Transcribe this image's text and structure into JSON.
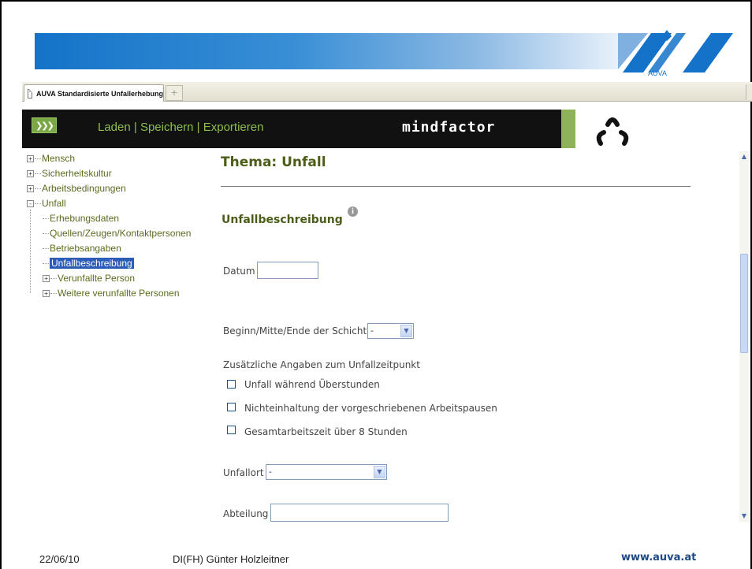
{
  "browser": {
    "tab_title": "AUVA Standardisierte Unfallerhebung",
    "new_tab": "+"
  },
  "banner": {
    "logo_text": "AUVA",
    "brand_color": "#1473c8"
  },
  "app_bar": {
    "menu": [
      "Laden",
      "Speichern",
      "Exportieren"
    ],
    "separator": " | ",
    "brand": "mindfactor",
    "accent": "#8db25a"
  },
  "tree": {
    "items": [
      {
        "label": "Mensch",
        "level": 1,
        "toggle": "+"
      },
      {
        "label": "Sicherheitskultur",
        "level": 1,
        "toggle": "+"
      },
      {
        "label": "Arbeitsbedingungen",
        "level": 1,
        "toggle": "+"
      },
      {
        "label": "Unfall",
        "level": 1,
        "toggle": "-"
      },
      {
        "label": "Erhebungsdaten",
        "level": 2,
        "toggle": ""
      },
      {
        "label": "Quellen/Zeugen/Kontaktpersonen",
        "level": 2,
        "toggle": ""
      },
      {
        "label": "Betriebsangaben",
        "level": 2,
        "toggle": ""
      },
      {
        "label": "Unfallbeschreibung",
        "level": 2,
        "toggle": "",
        "selected": true
      },
      {
        "label": "Verunfallte Person",
        "level": 2,
        "toggle": "+"
      },
      {
        "label": "Weitere verunfallte Personen",
        "level": 2,
        "toggle": "+"
      }
    ]
  },
  "main": {
    "title": "Thema: Unfall",
    "section": "Unfallbeschreibung",
    "info_icon": "i",
    "fields": {
      "datum_label": "Datum",
      "datum_value": "",
      "schicht_label": "Beginn/Mitte/Ende der Schicht",
      "schicht_value": "-",
      "zusatz_label": "Zusätzliche Angaben zum Unfallzeitpunkt",
      "checkboxes": [
        {
          "label": "Unfall während Überstunden",
          "checked": false
        },
        {
          "label": "Nichteinhaltung der vorgeschriebenen Arbeitspausen",
          "checked": false
        },
        {
          "label": "Gesamtarbeitszeit über 8 Stunden",
          "checked": false
        }
      ],
      "unfallort_label": "Unfallort",
      "unfallort_value": "-",
      "abteilung_label": "Abteilung",
      "abteilung_value": ""
    }
  },
  "footer": {
    "date": "22/06/10",
    "author": "DI(FH) Günter Holzleitner",
    "url": "www.auva.at"
  }
}
